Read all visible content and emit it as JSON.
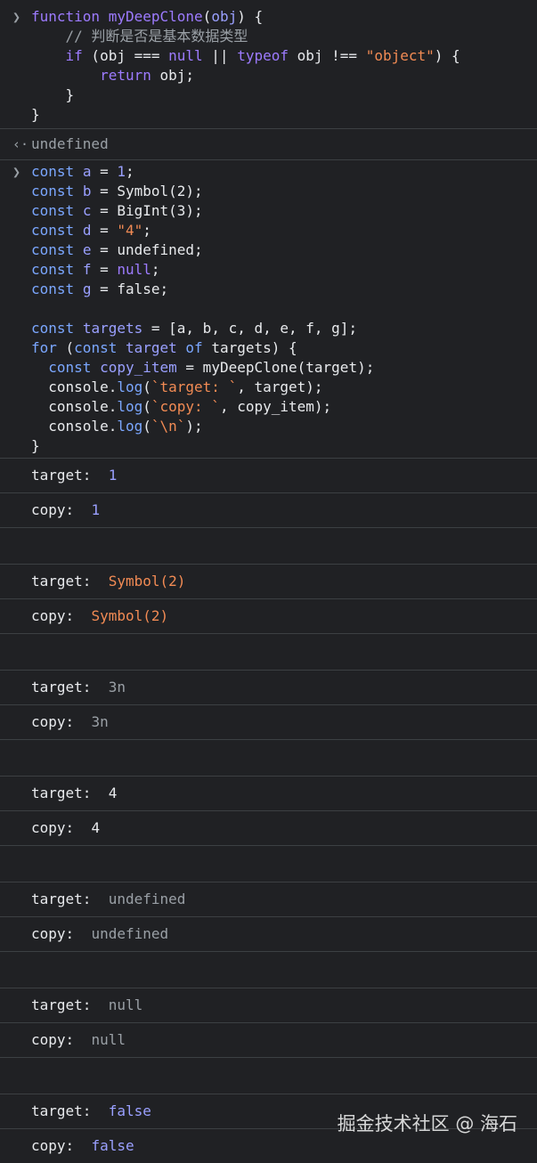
{
  "console": {
    "entry1": {
      "lines": [
        [
          "function",
          " ",
          "myDeepClone",
          "(",
          "obj",
          ") {"
        ],
        [
          "    ",
          "// 判断是否是基本数据类型"
        ],
        [
          "    ",
          "if",
          " (obj === ",
          "null",
          " || ",
          "typeof",
          " obj !== ",
          "\"object\"",
          ") {"
        ],
        [
          "        ",
          "return",
          " obj;"
        ],
        [
          "    ",
          "}"
        ],
        [
          "}"
        ]
      ]
    },
    "entry1_result": "undefined",
    "entry2": {
      "lines": [
        [
          "const",
          " ",
          "a",
          " = ",
          "1",
          ";"
        ],
        [
          "const",
          " ",
          "b",
          " = Symbol(2);"
        ],
        [
          "const",
          " ",
          "c",
          " = BigInt(3);"
        ],
        [
          "const",
          " ",
          "d",
          " = ",
          "\"4\"",
          ";"
        ],
        [
          "const",
          " ",
          "e",
          " = undefined;"
        ],
        [
          "const",
          " ",
          "f",
          " = ",
          "null",
          ";"
        ],
        [
          "const",
          " ",
          "g",
          " = false;"
        ],
        [
          ""
        ],
        [
          "const",
          " ",
          "targets",
          " = [a, b, c, d, e, f, g];"
        ],
        [
          "for",
          " (",
          "const",
          " ",
          "target",
          " ",
          "of",
          " targets) {"
        ],
        [
          "  ",
          "const",
          " ",
          "copy_item",
          " = myDeepClone(target);"
        ],
        [
          "  console.",
          "log",
          "(",
          "`target: `",
          ", target);"
        ],
        [
          "  console.",
          "log",
          "(",
          "`copy: `",
          ", copy_item);"
        ],
        [
          "  console.",
          "log",
          "(",
          "`\\n`",
          ");"
        ],
        [
          "}"
        ]
      ]
    },
    "output": [
      {
        "target_label": "target: ",
        "target_value": "1",
        "copy_label": "copy: ",
        "copy_value": "1",
        "kind": "num"
      },
      {
        "target_label": "target: ",
        "target_value": "Symbol(2)",
        "copy_label": "copy: ",
        "copy_value": "Symbol(2)",
        "kind": "sym"
      },
      {
        "target_label": "target: ",
        "target_value": "3n",
        "copy_label": "copy: ",
        "copy_value": "3n",
        "kind": "big"
      },
      {
        "target_label": "target: ",
        "target_value": "4",
        "copy_label": "copy: ",
        "copy_value": "4",
        "kind": "str"
      },
      {
        "target_label": "target: ",
        "target_value": "undefined",
        "copy_label": "copy: ",
        "copy_value": "undefined",
        "kind": "undef"
      },
      {
        "target_label": "target: ",
        "target_value": "null",
        "copy_label": "copy: ",
        "copy_value": "null",
        "kind": "null"
      },
      {
        "target_label": "target: ",
        "target_value": "false",
        "copy_label": "copy: ",
        "copy_value": "false",
        "kind": "bool"
      }
    ],
    "prompt_icon": "chevron-right-icon",
    "result_icon": "return-arrow-icon"
  },
  "watermark": "掘金技术社区 @ 海石",
  "colors": {
    "background": "#202124",
    "keyword": "#9d7bff",
    "string": "#f28b54",
    "number": "#9aa0ff",
    "comment": "#9aa0a6"
  }
}
